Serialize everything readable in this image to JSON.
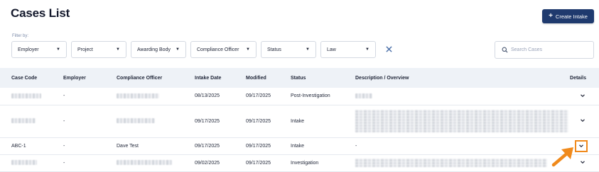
{
  "page": {
    "title": "Cases List"
  },
  "toolbar": {
    "create_label": "Create Intake",
    "create_icon": "plus-icon"
  },
  "filters": {
    "label": "Filter by:",
    "items": [
      {
        "name": "employer",
        "label": "Employer"
      },
      {
        "name": "project",
        "label": "Project"
      },
      {
        "name": "awarding-body",
        "label": "Awarding Body"
      },
      {
        "name": "compliance-officer",
        "label": "Compliance Officer"
      },
      {
        "name": "status",
        "label": "Status"
      },
      {
        "name": "law",
        "label": "Law"
      }
    ]
  },
  "search": {
    "placeholder": "Search Cases"
  },
  "table": {
    "headers": {
      "case_code": "Case Code",
      "employer": "Employer",
      "officer": "Compliance Officer",
      "intake_date": "Intake Date",
      "modified": "Modified",
      "status": "Status",
      "description": "Description / Overview",
      "details": "Details"
    },
    "rows": [
      {
        "case_code": "",
        "employer": "-",
        "officer": "",
        "intake_date": "08/13/2025",
        "modified": "09/17/2025",
        "status": "Post-Investigation",
        "description": ""
      },
      {
        "case_code": "",
        "employer": "-",
        "officer": "",
        "intake_date": "09/17/2025",
        "modified": "09/17/2025",
        "status": "Intake",
        "description": ""
      },
      {
        "case_code": "ABC-1",
        "employer": "-",
        "officer": "Dave Test",
        "intake_date": "09/17/2025",
        "modified": "09/17/2025",
        "status": "Intake",
        "description": "-"
      },
      {
        "case_code": "",
        "employer": "-",
        "officer": "",
        "intake_date": "09/02/2025",
        "modified": "09/17/2025",
        "status": "Investigation",
        "description": ""
      }
    ]
  },
  "colors": {
    "accent": "#1f3a6e",
    "highlight": "#f08a1c"
  }
}
